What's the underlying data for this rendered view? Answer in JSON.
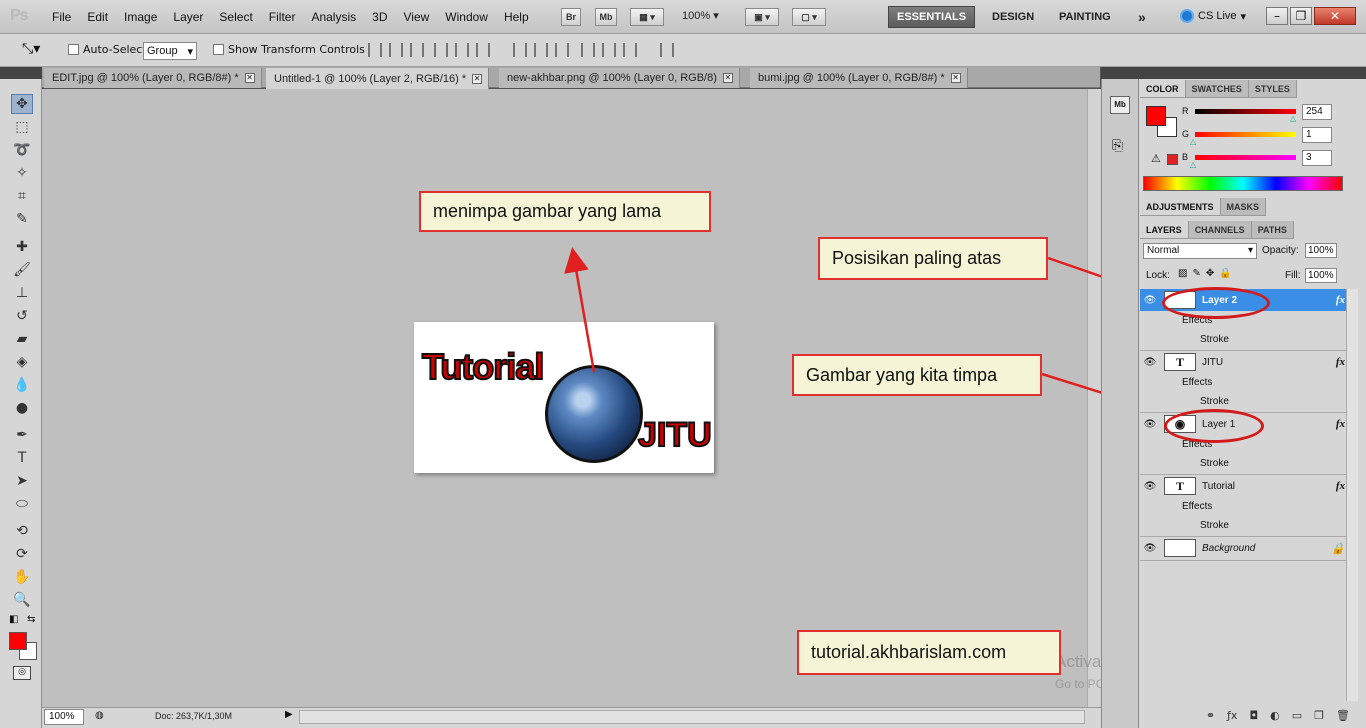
{
  "app": {
    "logo": "Ps"
  },
  "menu": [
    "File",
    "Edit",
    "Image",
    "Layer",
    "Select",
    "Filter",
    "Analysis",
    "3D",
    "View",
    "Window",
    "Help"
  ],
  "toolbar_buttons": {
    "br": "Br",
    "mb": "Mb",
    "zoom": "100%"
  },
  "workspaces": {
    "essentials": "ESSENTIALS",
    "design": "DESIGN",
    "painting": "PAINTING",
    "more": "»"
  },
  "cs_live": "CS Live",
  "options": {
    "auto_select_label": "Auto-Select:",
    "auto_select_value": "Group",
    "show_transform_label": "Show Transform Controls"
  },
  "tabs": [
    {
      "label": "EDIT.jpg @ 100% (Layer 0, RGB/8#) *"
    },
    {
      "label": "Untitled-1 @ 100% (Layer 2, RGB/16) *"
    },
    {
      "label": "new-akhbar.png @ 100% (Layer 0, RGB/8)"
    },
    {
      "label": "bumi.jpg @ 100% (Layer 0, RGB/8#) *"
    }
  ],
  "status": {
    "zoom": "100%",
    "doc": "Doc: 263,7K/1,30M"
  },
  "document": {
    "word1": "Tutorial",
    "word2": "JITU"
  },
  "callouts": {
    "top": "menimpa gambar yang lama",
    "posisi": "Posisikan paling atas",
    "gambar": "Gambar yang kita timpa",
    "url": "tutorial.akhbarislam.com"
  },
  "watermark": {
    "title": "Activate Windows",
    "sub": "Go to PC settings to activate Windows."
  },
  "color_panel": {
    "tabs": [
      "COLOR",
      "SWATCHES",
      "STYLES"
    ],
    "r_label": "R",
    "g_label": "G",
    "b_label": "B",
    "r": "254",
    "g": "1",
    "b": "3",
    "fg_color": "#fe0103"
  },
  "adjust_tabs": [
    "ADJUSTMENTS",
    "MASKS"
  ],
  "layers_panel": {
    "tabs": [
      "LAYERS",
      "CHANNELS",
      "PATHS"
    ],
    "blend": "Normal",
    "opacity_label": "Opacity:",
    "opacity": "100%",
    "lock_label": "Lock:",
    "fill_label": "Fill:",
    "fill": "100%"
  },
  "layers": [
    {
      "name": "Layer 2",
      "effects": "Effects",
      "stroke": "Stroke",
      "fx": "fx"
    },
    {
      "name": "JITU",
      "effects": "Effects",
      "stroke": "Stroke",
      "fx": "fx",
      "thumb": "T"
    },
    {
      "name": "Layer 1",
      "effects": "Effects",
      "stroke": "Stroke",
      "fx": "fx"
    },
    {
      "name": "Tutorial",
      "effects": "Effects",
      "stroke": "Stroke",
      "fx": "fx",
      "thumb": "T"
    },
    {
      "name": "Background"
    }
  ],
  "colors": {
    "selection": "#3a8ee6",
    "annotation_red": "#e03030",
    "callout_bg": "#f5f4d6"
  }
}
